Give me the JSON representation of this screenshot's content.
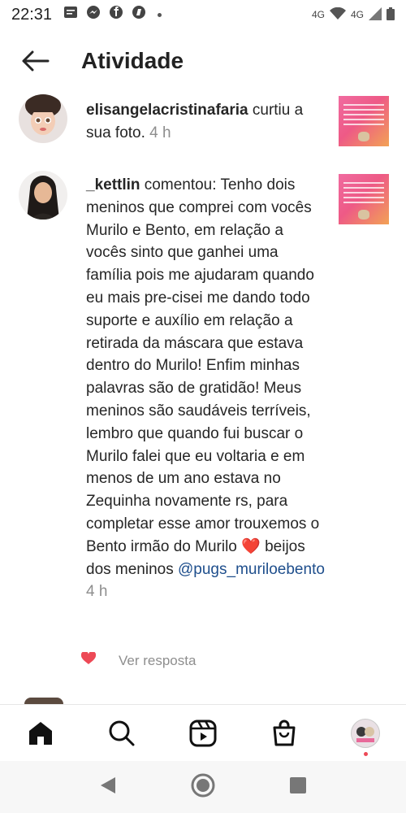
{
  "status_bar": {
    "time": "22:31",
    "network_left": "4G",
    "network_right": "4G"
  },
  "header": {
    "title": "Atividade"
  },
  "notifications": [
    {
      "username": "elisangelacristinafaria",
      "text": " curtiu a sua foto.",
      "time": "4 h"
    },
    {
      "username": "_kettlin",
      "text": " comentou: Tenho dois meninos que comprei com vocês Murilo e Bento, em relação a vocês sinto que ganhei uma família pois me ajudaram quando eu mais pre-cisei me dando todo suporte e auxílio em relação a retirada da máscara que estava dentro do Murilo!  Enfim minhas palavras são de gratidão! Meus meninos são saudáveis terríveis, lembro que quando fui buscar o Murilo falei que eu voltaria e em menos de um ano estava no Zequinha novamente rs, para completar esse amor trouxemos o Bento irmão do Murilo ",
      "emoji": "❤️",
      "text_after": " beijos dos meninos ",
      "mention": "@pugs_muriloebento",
      "time": "4 h",
      "reply_label": "Ver resposta"
    }
  ],
  "bottom_nav": [
    "home-icon",
    "search-icon",
    "reels-icon",
    "shop-icon",
    "profile"
  ],
  "colors": {
    "heart": "#ed4956",
    "mention": "#1e4e8c",
    "muted": "#8e8e8e"
  }
}
